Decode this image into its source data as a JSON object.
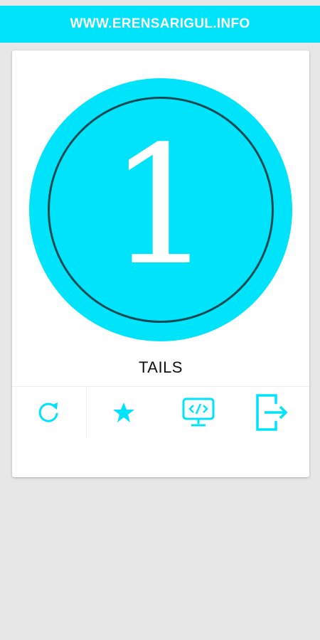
{
  "header": {
    "title": "WWW.ERENSARIGUL.INFO"
  },
  "coin": {
    "face_value": "1",
    "result_label": "TAILS"
  },
  "toolbar": {
    "icons": [
      "refresh-icon",
      "star-icon",
      "code-monitor-icon",
      "exit-icon"
    ]
  },
  "colors": {
    "accent": "#00e4fb",
    "ring": "#0d4a52",
    "background": "#e7e7e7",
    "card": "#ffffff"
  }
}
